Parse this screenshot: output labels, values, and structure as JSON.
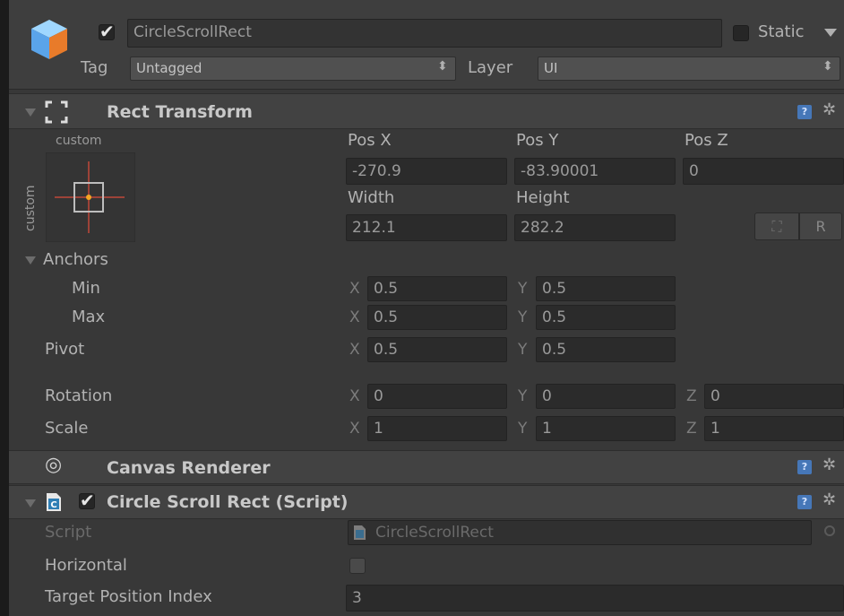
{
  "header": {
    "object_name": "CircleScrollRect",
    "static_label": "Static",
    "tag_label": "Tag",
    "tag_value": "Untagged",
    "layer_label": "Layer",
    "layer_value": "UI",
    "dropdown_glyph": "⬍"
  },
  "rect_transform": {
    "title": "Rect Transform",
    "anchor_preset_top": "custom",
    "anchor_preset_side": "custom",
    "pos_x_label": "Pos X",
    "pos_y_label": "Pos Y",
    "pos_z_label": "Pos Z",
    "pos_x": "-270.9",
    "pos_y": "-83.90001",
    "pos_z": "0",
    "width_label": "Width",
    "height_label": "Height",
    "width": "212.1",
    "height": "282.2",
    "raw_button": "R",
    "blueprint_glyph": "⛶",
    "anchors_label": "Anchors",
    "min_label": "Min",
    "max_label": "Max",
    "pivot_label": "Pivot",
    "rotation_label": "Rotation",
    "scale_label": "Scale",
    "x": "X",
    "y": "Y",
    "z": "Z",
    "anchor_min_x": "0.5",
    "anchor_min_y": "0.5",
    "anchor_max_x": "0.5",
    "anchor_max_y": "0.5",
    "pivot_x": "0.5",
    "pivot_y": "0.5",
    "rot_x": "0",
    "rot_y": "0",
    "rot_z": "0",
    "scale_x": "1",
    "scale_y": "1",
    "scale_z": "1"
  },
  "canvas_renderer": {
    "title": "Canvas Renderer"
  },
  "script_component": {
    "title": "Circle Scroll Rect (Script)",
    "script_label": "Script",
    "script_value": "CircleScrollRect",
    "horizontal_label": "Horizontal",
    "horizontal_checked": false,
    "target_label": "Target Position Index",
    "target_value": "3"
  },
  "icons": {
    "help": "?",
    "gear": "✲",
    "eye": "◎"
  },
  "colors": {
    "panel": "#383838",
    "header": "#3e3e3e",
    "field": "#2b2b2b",
    "help_blue": "#4677b8"
  }
}
